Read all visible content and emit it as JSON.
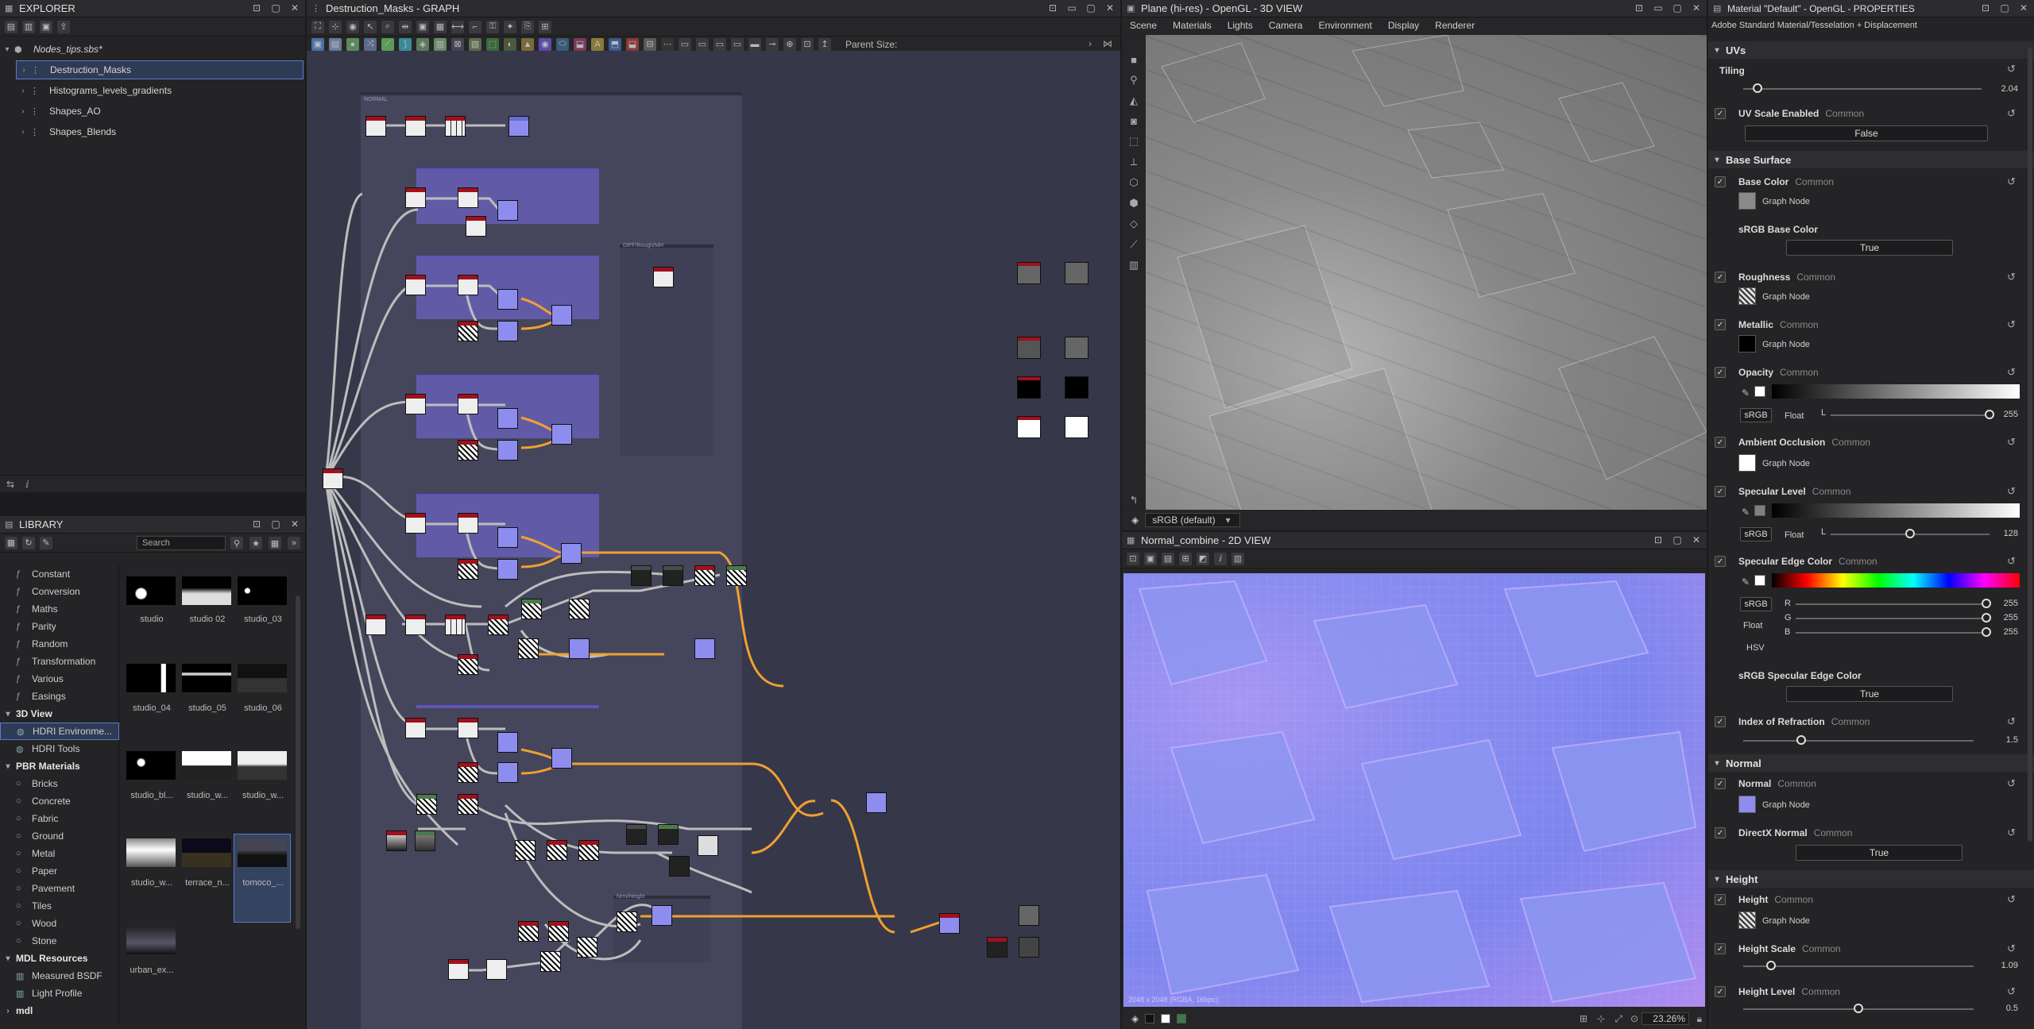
{
  "explorer": {
    "title": "EXPLORER",
    "package": "Nodes_tips.sbs*",
    "items": [
      {
        "label": "Destruction_Masks"
      },
      {
        "label": "Histograms_levels_gradients"
      },
      {
        "label": "Shapes_AO"
      },
      {
        "label": "Shapes_Blends"
      }
    ]
  },
  "library": {
    "title": "LIBRARY",
    "search_placeholder": "Search",
    "categories_top": [
      "Constant",
      "Conversion",
      "Maths",
      "Parity",
      "Random",
      "Transformation",
      "Various",
      "Easings"
    ],
    "group_3d": {
      "label": "3D View",
      "items": [
        "HDRI Environme...",
        "HDRI Tools"
      ]
    },
    "group_pbr": {
      "label": "PBR Materials",
      "items": [
        "Bricks",
        "Concrete",
        "Fabric",
        "Ground",
        "Metal",
        "Paper",
        "Pavement",
        "Tiles",
        "Wood",
        "Stone"
      ]
    },
    "group_mdl": {
      "label": "MDL Resources",
      "items": [
        "Measured BSDF",
        "Light Profile"
      ]
    },
    "group_mdl2": {
      "label": "mdl"
    },
    "thumbs": [
      "studio",
      "studio 02",
      "studio_03",
      "studio_04",
      "studio_05",
      "studio_06",
      "studio_bl...",
      "studio_w...",
      "studio_w...",
      "studio_w...",
      "terrace_n...",
      "tomoco_...",
      "urban_ex..."
    ]
  },
  "graph": {
    "title": "Destruction_Masks - GRAPH",
    "parent_size_label": "Parent Size:",
    "frame_label_1": "NORMAL",
    "frame_label_2": "DIFF/Rough/MH",
    "frame_label_3": "Nrm/Height"
  },
  "view3d": {
    "title": "Plane (hi-res) - OpenGL - 3D VIEW",
    "menu": [
      "Scene",
      "Materials",
      "Lights",
      "Camera",
      "Environment",
      "Display",
      "Renderer"
    ],
    "colorspace": "sRGB (default)"
  },
  "view2d": {
    "title": "Normal_combine - 2D VIEW",
    "zoom": "23.26%",
    "info": "2048 x 2048 (RGBA, 16bpc)"
  },
  "properties": {
    "title": "Material \"Default\" - OpenGL - PROPERTIES",
    "subtitle": "Adobe Standard Material/Tesselation + Displacement",
    "common": "Common",
    "graph_node": "Graph Node",
    "sections": {
      "uvs": "UVs",
      "base": "Base Surface",
      "normal": "Normal",
      "height": "Height"
    },
    "tiling": {
      "label": "Tiling",
      "value": "2.04",
      "fraction": 0.06
    },
    "uv_scale": {
      "label": "UV Scale Enabled",
      "value": "False"
    },
    "base_color": {
      "label": "Base Color",
      "color": "#8a8a8a"
    },
    "srgb_base": {
      "label": "sRGB Base Color",
      "value": "True"
    },
    "roughness": {
      "label": "Roughness"
    },
    "metallic": {
      "label": "Metallic",
      "color": "#000000"
    },
    "opacity": {
      "label": "Opacity",
      "srgb": "sRGB",
      "float": "Float",
      "channel": "L",
      "value": "255",
      "fraction": 1.0
    },
    "ao": {
      "label": "Ambient Occlusion",
      "color": "#ffffff"
    },
    "specular_level": {
      "label": "Specular Level",
      "srgb": "sRGB",
      "float": "Float",
      "channel": "L",
      "value": "128",
      "fraction": 0.5
    },
    "specular_edge": {
      "label": "Specular Edge Color",
      "srgb": "sRGB",
      "float": "Float",
      "hsv": "HSV",
      "r_label": "R",
      "g_label": "G",
      "b_label": "B",
      "r": "255",
      "g": "255",
      "b": "255"
    },
    "srgb_spec_edge": {
      "label": "sRGB Specular Edge Color",
      "value": "True"
    },
    "ior": {
      "label": "Index of Refraction",
      "value": "1.5",
      "fraction": 0.25
    },
    "normal": {
      "label": "Normal",
      "color": "#8d8df0"
    },
    "directx": {
      "label": "DirectX Normal",
      "value": "True"
    },
    "height": {
      "label": "Height"
    },
    "height_scale": {
      "label": "Height Scale",
      "value": "1.09",
      "fraction": 0.12
    },
    "height_level": {
      "label": "Height Level",
      "value": "0.5",
      "fraction": 0.5
    }
  }
}
